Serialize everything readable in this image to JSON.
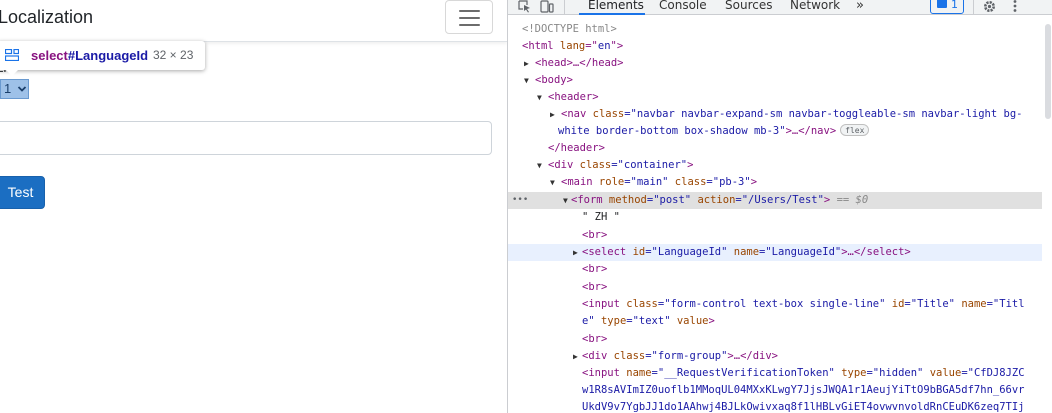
{
  "page": {
    "brand": "Localization",
    "tooltip": {
      "tag": "select",
      "id": "#LanguageId",
      "size": "32 × 23"
    },
    "text_zh": "ZH",
    "select_value": "1",
    "button_label": "Test"
  },
  "devtools": {
    "tabs": [
      "Elements",
      "Console",
      "Sources",
      "Network"
    ],
    "more_tabs": "»",
    "issues_count": "1",
    "colors": {
      "accent": "#1a73e8",
      "tag": "#881280",
      "attr_name": "#994500",
      "attr_value": "#1a1aa6",
      "button": "#1b6ec2"
    },
    "dom": {
      "doctype": "<!DOCTYPE html>",
      "html_open": "<html",
      "html_lang_attr": " lang",
      "html_lang_eq": "=\"",
      "html_lang_val": "en",
      "html_close": "\">",
      "head": "<head>…</head>",
      "body": "<body>",
      "header": "<header>",
      "nav_tag": "<nav",
      "nav_class_attr": " class",
      "nav_class_val_1": "=\"navbar navbar-expand-sm navbar-toggleable-sm navbar-light bg-",
      "nav_class_val_2": "white border-bottom box-shadow mb-3\"",
      "nav_close": ">…</nav>",
      "flex_badge": "flex",
      "header_close": "</header>",
      "div_container_tag": "<div",
      "div_container_attr": " class",
      "div_container_val": "=\"container\"",
      "div_container_close": ">",
      "main_tag": "<main",
      "main_role_attr": " role",
      "main_role_val": "=\"main\"",
      "main_class_attr": " class",
      "main_class_val": "=\"pb-3\"",
      "main_close": ">",
      "form_tag": "<form",
      "form_method_attr": " method",
      "form_method_val": "=\"post\"",
      "form_action_attr": " action",
      "form_action_val": "=\"/Users/Test\"",
      "form_close": ">",
      "form_marker": " == $0",
      "text_node": "\" ZH \"",
      "br": "<br>",
      "select_tag": "<select",
      "select_id_attr": " id",
      "select_id_val": "=\"LanguageId\"",
      "select_name_attr": " name",
      "select_name_val": "=\"LanguageId\"",
      "select_close": ">…</select>",
      "input_tag": "<input",
      "input_class_attr": " class",
      "input_class_val": "=\"form-control text-box single-line\"",
      "input_id_attr": " id",
      "input_id_val": "=\"Title\"",
      "input_name_attr": " name",
      "input_name_val_1": "=\"Titl",
      "input_name_val_2": "e\"",
      "input_type_attr": " type",
      "input_type_val": "=\"text\"",
      "input_value_attr": " value",
      "input_close": ">",
      "div_fg_tag": "<div",
      "div_fg_attr": " class",
      "div_fg_val": "=\"form-group\"",
      "div_fg_close": ">…</div>",
      "token_tag": "<input",
      "token_name_attr": " name",
      "token_name_val": "=\"__RequestVerificationToken\"",
      "token_type_attr": " type",
      "token_type_val": "=\"hidden\"",
      "token_value_attr": " value",
      "token_value_1": "=\"CfDJ8JZC",
      "token_value_2": "w1R8sAVImIZ0uoflb1MMoqUL04MXxKLwgY7JjsJWQA1r1AeujYiTtO9bBGA5df7hn_66vr",
      "token_value_3": "UkdV9v7YgbJJ1do1AAhwj4BJLkOwivxaq8f1lHBLvGiET4ovwvnvoldRnCEuDK6zeq7TIj"
    }
  }
}
